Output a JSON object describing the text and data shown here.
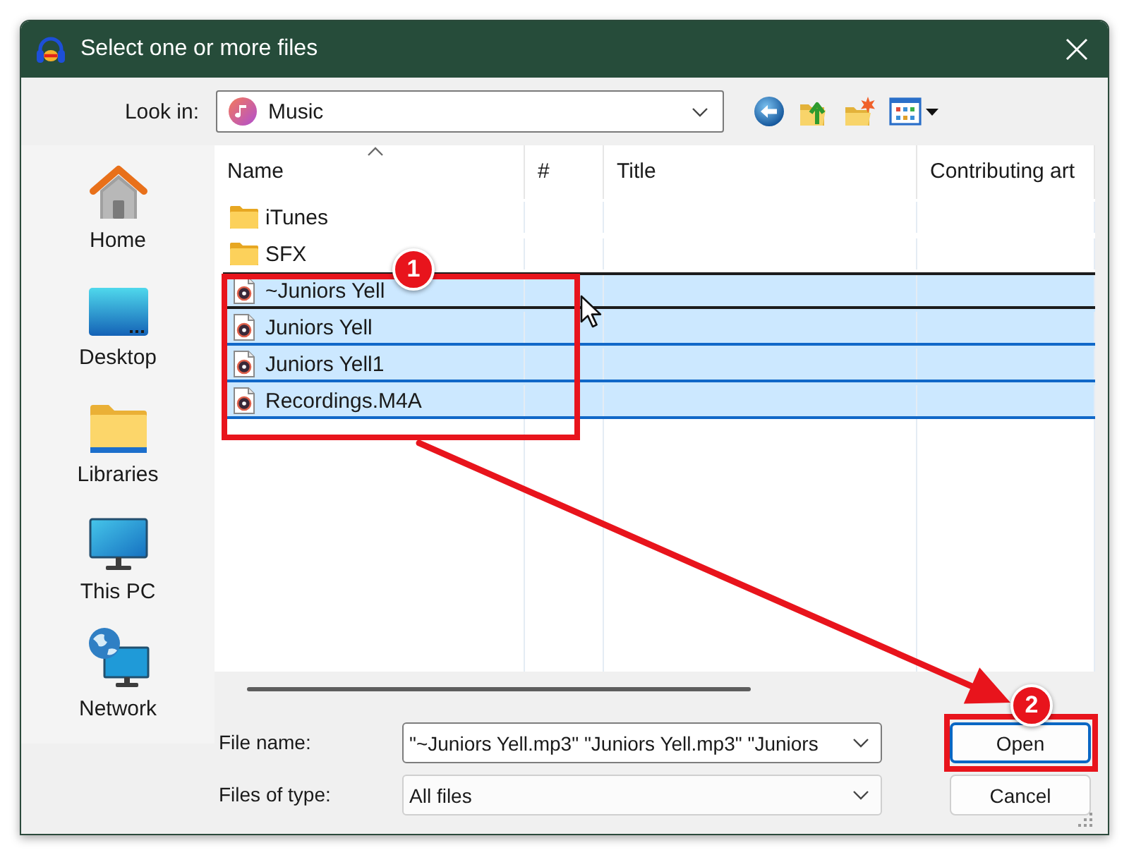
{
  "window": {
    "title": "Select one or more files"
  },
  "look_in": {
    "label": "Look in:",
    "value": "Music"
  },
  "places": [
    {
      "label": "Home",
      "kind": "home"
    },
    {
      "label": "Desktop",
      "kind": "desktop"
    },
    {
      "label": "Libraries",
      "kind": "libraries"
    },
    {
      "label": "This PC",
      "kind": "computer"
    },
    {
      "label": "Network",
      "kind": "network"
    }
  ],
  "file_list": {
    "columns": [
      {
        "label": "Name",
        "sorted": true
      },
      {
        "label": "#",
        "sorted": false
      },
      {
        "label": "Title",
        "sorted": false
      },
      {
        "label": "Contributing art",
        "sorted": false
      }
    ],
    "rows": [
      {
        "name": "iTunes",
        "kind": "folder",
        "selected": false,
        "focused": false
      },
      {
        "name": "SFX",
        "kind": "folder",
        "selected": false,
        "focused": false
      },
      {
        "name": "~Juniors Yell",
        "kind": "audio",
        "selected": true,
        "focused": true
      },
      {
        "name": "Juniors Yell",
        "kind": "audio",
        "selected": true,
        "focused": false
      },
      {
        "name": "Juniors Yell1",
        "kind": "audio",
        "selected": true,
        "focused": false
      },
      {
        "name": "Recordings.M4A",
        "kind": "audio",
        "selected": true,
        "focused": false
      }
    ]
  },
  "file_name": {
    "label": "File name:",
    "value": "\"~Juniors Yell.mp3\" \"Juniors Yell.mp3\" \"Juniors"
  },
  "file_type": {
    "label": "Files of type:",
    "value": "All files"
  },
  "buttons": [
    {
      "label": "Open",
      "default": true
    },
    {
      "label": "Cancel",
      "default": false
    }
  ],
  "callouts": [
    {
      "label": "1"
    },
    {
      "label": "2"
    }
  ]
}
